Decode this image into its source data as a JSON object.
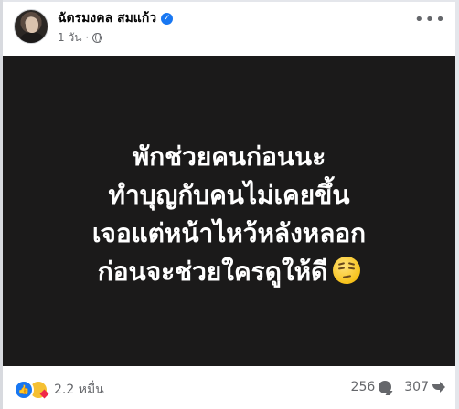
{
  "post": {
    "author": "ฉัตรมงคล สมแก้ว",
    "verified": true,
    "time": "1 วัน",
    "privacy_icon": "globe-icon",
    "more_icon": "more-options-icon"
  },
  "image": {
    "lines": [
      "พักช่วยคนก่อนนะ",
      "ทำบุญกับคนไม่เคยขึ้น",
      "เจอแต่หน้าไหว้หลังหลอก",
      "ก่อนจะช่วยใครดูให้ดี"
    ],
    "emoji": "unamused-face-emoji",
    "background": "#1b1a1a",
    "text_color": "#ffffff"
  },
  "footer": {
    "reactions_count": "2.2 หมื่น",
    "reaction_icons": [
      "like-icon",
      "care-icon"
    ],
    "comments_count": "256",
    "shares_count": "307"
  }
}
